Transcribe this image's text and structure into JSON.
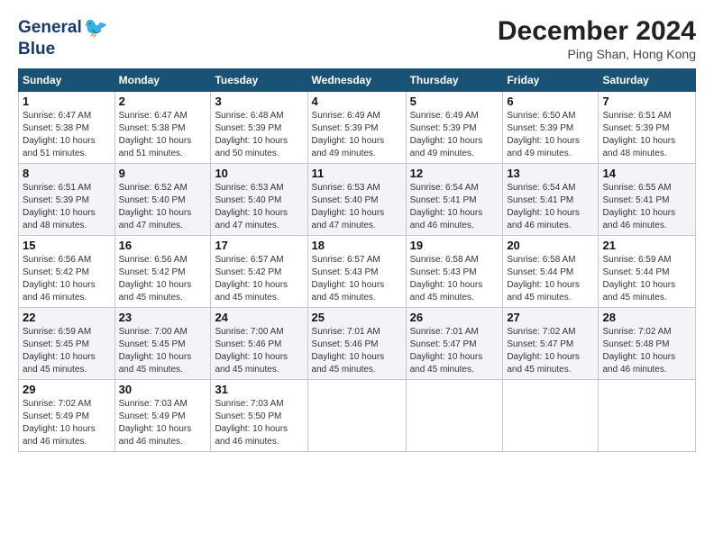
{
  "header": {
    "logo_line1": "General",
    "logo_line2": "Blue",
    "month": "December 2024",
    "location": "Ping Shan, Hong Kong"
  },
  "days_of_week": [
    "Sunday",
    "Monday",
    "Tuesday",
    "Wednesday",
    "Thursday",
    "Friday",
    "Saturday"
  ],
  "weeks": [
    [
      {
        "day": "1",
        "info": "Sunrise: 6:47 AM\nSunset: 5:38 PM\nDaylight: 10 hours\nand 51 minutes."
      },
      {
        "day": "2",
        "info": "Sunrise: 6:47 AM\nSunset: 5:38 PM\nDaylight: 10 hours\nand 51 minutes."
      },
      {
        "day": "3",
        "info": "Sunrise: 6:48 AM\nSunset: 5:39 PM\nDaylight: 10 hours\nand 50 minutes."
      },
      {
        "day": "4",
        "info": "Sunrise: 6:49 AM\nSunset: 5:39 PM\nDaylight: 10 hours\nand 49 minutes."
      },
      {
        "day": "5",
        "info": "Sunrise: 6:49 AM\nSunset: 5:39 PM\nDaylight: 10 hours\nand 49 minutes."
      },
      {
        "day": "6",
        "info": "Sunrise: 6:50 AM\nSunset: 5:39 PM\nDaylight: 10 hours\nand 49 minutes."
      },
      {
        "day": "7",
        "info": "Sunrise: 6:51 AM\nSunset: 5:39 PM\nDaylight: 10 hours\nand 48 minutes."
      }
    ],
    [
      {
        "day": "8",
        "info": "Sunrise: 6:51 AM\nSunset: 5:39 PM\nDaylight: 10 hours\nand 48 minutes."
      },
      {
        "day": "9",
        "info": "Sunrise: 6:52 AM\nSunset: 5:40 PM\nDaylight: 10 hours\nand 47 minutes."
      },
      {
        "day": "10",
        "info": "Sunrise: 6:53 AM\nSunset: 5:40 PM\nDaylight: 10 hours\nand 47 minutes."
      },
      {
        "day": "11",
        "info": "Sunrise: 6:53 AM\nSunset: 5:40 PM\nDaylight: 10 hours\nand 47 minutes."
      },
      {
        "day": "12",
        "info": "Sunrise: 6:54 AM\nSunset: 5:41 PM\nDaylight: 10 hours\nand 46 minutes."
      },
      {
        "day": "13",
        "info": "Sunrise: 6:54 AM\nSunset: 5:41 PM\nDaylight: 10 hours\nand 46 minutes."
      },
      {
        "day": "14",
        "info": "Sunrise: 6:55 AM\nSunset: 5:41 PM\nDaylight: 10 hours\nand 46 minutes."
      }
    ],
    [
      {
        "day": "15",
        "info": "Sunrise: 6:56 AM\nSunset: 5:42 PM\nDaylight: 10 hours\nand 46 minutes."
      },
      {
        "day": "16",
        "info": "Sunrise: 6:56 AM\nSunset: 5:42 PM\nDaylight: 10 hours\nand 45 minutes."
      },
      {
        "day": "17",
        "info": "Sunrise: 6:57 AM\nSunset: 5:42 PM\nDaylight: 10 hours\nand 45 minutes."
      },
      {
        "day": "18",
        "info": "Sunrise: 6:57 AM\nSunset: 5:43 PM\nDaylight: 10 hours\nand 45 minutes."
      },
      {
        "day": "19",
        "info": "Sunrise: 6:58 AM\nSunset: 5:43 PM\nDaylight: 10 hours\nand 45 minutes."
      },
      {
        "day": "20",
        "info": "Sunrise: 6:58 AM\nSunset: 5:44 PM\nDaylight: 10 hours\nand 45 minutes."
      },
      {
        "day": "21",
        "info": "Sunrise: 6:59 AM\nSunset: 5:44 PM\nDaylight: 10 hours\nand 45 minutes."
      }
    ],
    [
      {
        "day": "22",
        "info": "Sunrise: 6:59 AM\nSunset: 5:45 PM\nDaylight: 10 hours\nand 45 minutes."
      },
      {
        "day": "23",
        "info": "Sunrise: 7:00 AM\nSunset: 5:45 PM\nDaylight: 10 hours\nand 45 minutes."
      },
      {
        "day": "24",
        "info": "Sunrise: 7:00 AM\nSunset: 5:46 PM\nDaylight: 10 hours\nand 45 minutes."
      },
      {
        "day": "25",
        "info": "Sunrise: 7:01 AM\nSunset: 5:46 PM\nDaylight: 10 hours\nand 45 minutes."
      },
      {
        "day": "26",
        "info": "Sunrise: 7:01 AM\nSunset: 5:47 PM\nDaylight: 10 hours\nand 45 minutes."
      },
      {
        "day": "27",
        "info": "Sunrise: 7:02 AM\nSunset: 5:47 PM\nDaylight: 10 hours\nand 45 minutes."
      },
      {
        "day": "28",
        "info": "Sunrise: 7:02 AM\nSunset: 5:48 PM\nDaylight: 10 hours\nand 46 minutes."
      }
    ],
    [
      {
        "day": "29",
        "info": "Sunrise: 7:02 AM\nSunset: 5:49 PM\nDaylight: 10 hours\nand 46 minutes."
      },
      {
        "day": "30",
        "info": "Sunrise: 7:03 AM\nSunset: 5:49 PM\nDaylight: 10 hours\nand 46 minutes."
      },
      {
        "day": "31",
        "info": "Sunrise: 7:03 AM\nSunset: 5:50 PM\nDaylight: 10 hours\nand 46 minutes."
      },
      {
        "day": "",
        "info": ""
      },
      {
        "day": "",
        "info": ""
      },
      {
        "day": "",
        "info": ""
      },
      {
        "day": "",
        "info": ""
      }
    ]
  ]
}
